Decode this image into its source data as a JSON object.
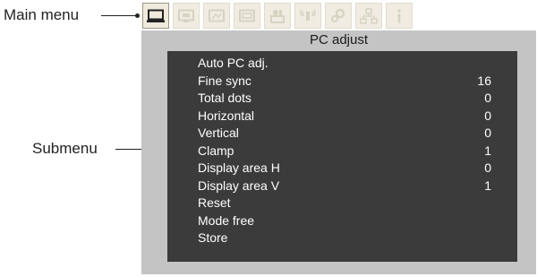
{
  "callouts": {
    "main_menu": "Main menu",
    "submenu": "Submenu"
  },
  "main_menu": {
    "tabs": [
      {
        "icon": "monitor-icon",
        "active": true
      },
      {
        "icon": "image-adjust-icon",
        "active": false
      },
      {
        "icon": "screen-icon",
        "active": false
      },
      {
        "icon": "input-icon",
        "active": false
      },
      {
        "icon": "setting-icon",
        "active": false
      },
      {
        "icon": "sound-icon",
        "active": false
      },
      {
        "icon": "gear-icon",
        "active": false
      },
      {
        "icon": "network-icon",
        "active": false
      },
      {
        "icon": "info-icon",
        "active": false
      }
    ]
  },
  "panel": {
    "title": "PC adjust"
  },
  "submenu": {
    "items": [
      {
        "label": "Auto PC adj.",
        "value": ""
      },
      {
        "label": "Fine sync",
        "value": "16"
      },
      {
        "label": "Total dots",
        "value": "0"
      },
      {
        "label": "Horizontal",
        "value": "0"
      },
      {
        "label": "Vertical",
        "value": "0"
      },
      {
        "label": "Clamp",
        "value": "1"
      },
      {
        "label": "Display area H",
        "value": "0"
      },
      {
        "label": "Display area V",
        "value": "1"
      },
      {
        "label": "Reset",
        "value": ""
      },
      {
        "label": "Mode free",
        "value": ""
      },
      {
        "label": "Store",
        "value": ""
      }
    ]
  },
  "colors": {
    "panel_bg": "#c4c4c4",
    "submenu_bg": "#3b3b3b",
    "tab_bg": "#f0ece2",
    "icon_inactive": "#d8d2c2",
    "icon_active": "#222222"
  }
}
